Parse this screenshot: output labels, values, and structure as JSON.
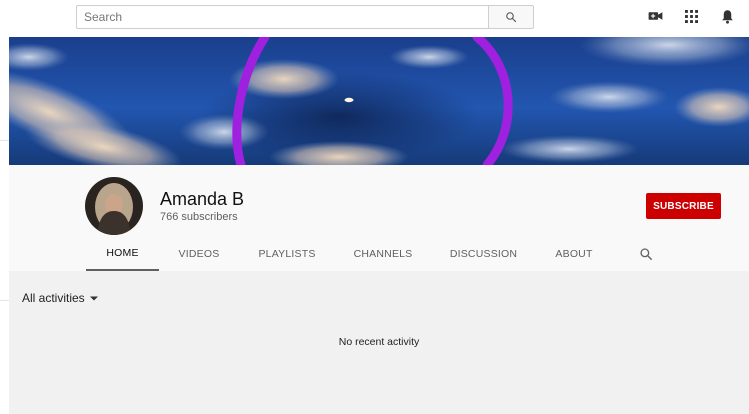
{
  "search": {
    "placeholder": "Search"
  },
  "icons": {
    "search": "search-icon",
    "create": "video-camera-icon",
    "apps": "apps-grid-icon",
    "notifications": "bell-icon",
    "tab_search": "search-icon",
    "dropdown": "caret-down-icon"
  },
  "channel": {
    "name": "Amanda B",
    "subscribers": "766 subscribers",
    "subscribe_label": "SUBSCRIBE"
  },
  "tabs": [
    {
      "label": "HOME",
      "active": true
    },
    {
      "label": "VIDEOS",
      "active": false
    },
    {
      "label": "PLAYLISTS",
      "active": false
    },
    {
      "label": "CHANNELS",
      "active": false
    },
    {
      "label": "DISCUSSION",
      "active": false
    },
    {
      "label": "ABOUT",
      "active": false
    }
  ],
  "feed": {
    "filter_label": "All activities",
    "empty_message": "No recent activity"
  },
  "colors": {
    "subscribe": "#cc0000",
    "banner_sky": "#1d4ea0",
    "banner_stroke": "#a020e0",
    "header_bg": "#f9f9f9",
    "content_bg": "#f1f1f1"
  }
}
